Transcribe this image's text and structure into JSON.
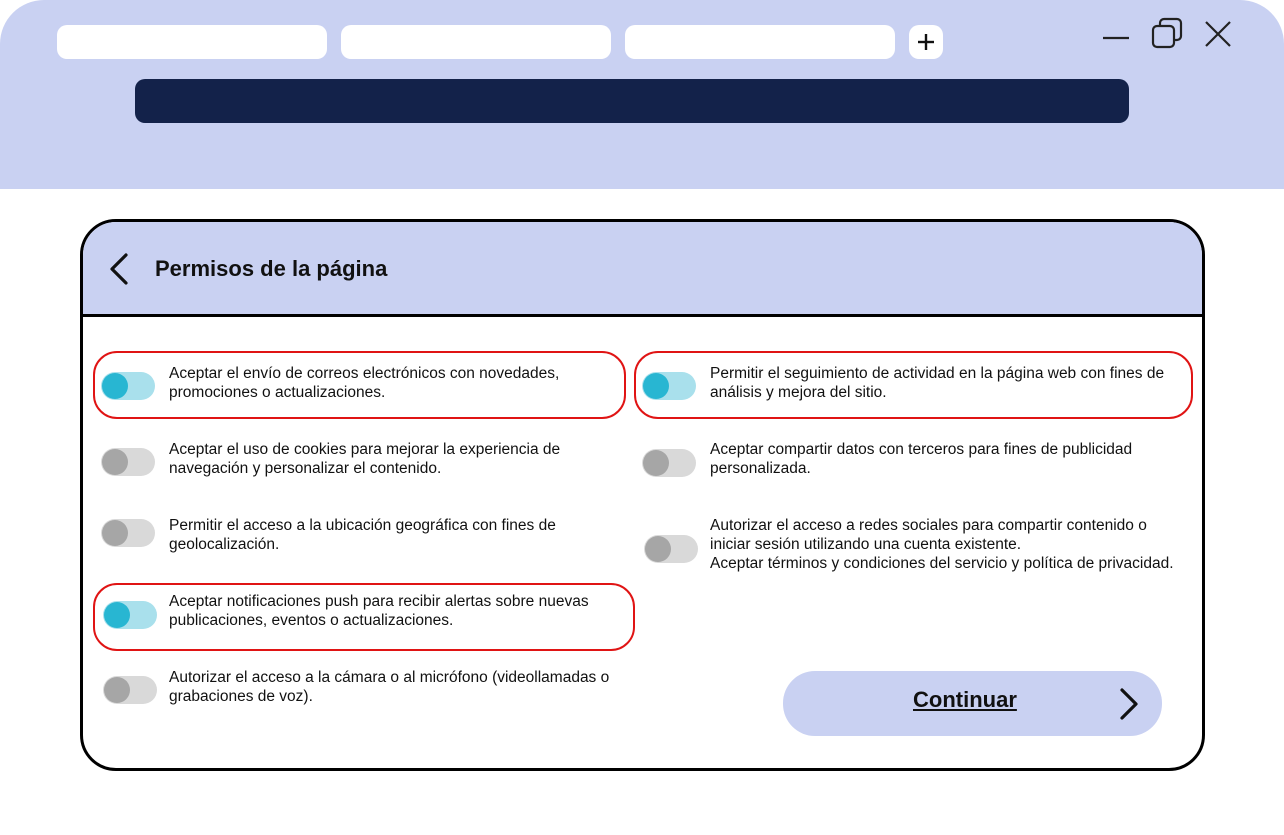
{
  "browser": {
    "tabs": [
      "",
      "",
      ""
    ],
    "new_tab_icon": "plus-icon",
    "window_controls": [
      "minimize-icon",
      "restore-icon",
      "close-icon"
    ],
    "address_bar_value": ""
  },
  "dialog": {
    "title": "Permisos de la página",
    "back_icon": "chevron-left-icon",
    "left_permissions": [
      {
        "label": "Aceptar el envío de correos electrónicos con novedades, promociones o actualizaciones.",
        "enabled": true,
        "highlighted": true
      },
      {
        "label": "Aceptar el uso de cookies para mejorar la experiencia de navegación y personalizar el contenido.",
        "enabled": false,
        "highlighted": false
      },
      {
        "label": "Permitir el acceso a la ubicación geográfica con fines de geolocalización.",
        "enabled": false,
        "highlighted": false
      },
      {
        "label": "Aceptar notificaciones push para recibir alertas sobre nuevas publicaciones, eventos o actualizaciones.",
        "enabled": true,
        "highlighted": true
      },
      {
        "label": "Autorizar el acceso a la cámara o al micrófono (videollamadas o grabaciones de voz).",
        "enabled": false,
        "highlighted": false
      }
    ],
    "right_permissions": [
      {
        "label": "Permitir el seguimiento de actividad en la página web con fines de análisis y mejora del sitio.",
        "enabled": true,
        "highlighted": true
      },
      {
        "label": "Aceptar compartir datos con terceros para fines de publicidad personalizada.",
        "enabled": false,
        "highlighted": false
      },
      {
        "label": "Autorizar el acceso a redes sociales para compartir contenido o iniciar sesión utilizando una cuenta existente.\nAceptar términos y condiciones del servicio y política de privacidad.",
        "enabled": false,
        "highlighted": false
      }
    ],
    "continue_label": "Continuar",
    "continue_icon": "chevron-right-icon"
  },
  "colors": {
    "chrome_background": "#c9d1f2",
    "address_bar": "#13224a",
    "toggle_on_track": "#a9e0ec",
    "toggle_on_knob": "#28b6d2",
    "toggle_off_track": "#d9d9d9",
    "toggle_off_knob": "#a6a6a6",
    "highlight_outline": "#e01414"
  }
}
